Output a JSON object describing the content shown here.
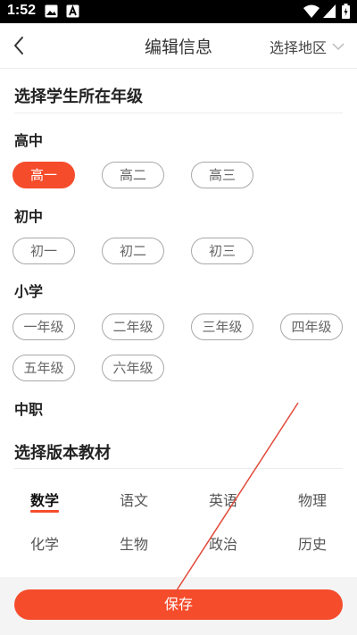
{
  "status_bar": {
    "time": "1:52",
    "icons": [
      "image-icon",
      "a-app-icon",
      "wifi-icon",
      "signal-icon",
      "battery-icon"
    ]
  },
  "nav": {
    "title": "编辑信息",
    "region_label": "选择地区",
    "back_icon": "chevron-left-icon"
  },
  "grade_section": {
    "heading": "选择学生所在年级",
    "groups": [
      {
        "label": "高中",
        "grades": [
          "高一",
          "高二",
          "高三"
        ],
        "selected": "高一"
      },
      {
        "label": "初中",
        "grades": [
          "初一",
          "初二",
          "初三"
        ]
      },
      {
        "label": "小学",
        "grades": [
          "一年级",
          "二年级",
          "三年级",
          "四年级",
          "五年级",
          "六年级"
        ]
      },
      {
        "label": "中职",
        "grades": []
      }
    ]
  },
  "textbook_section": {
    "heading": "选择版本教材",
    "subjects": [
      "数学",
      "语文",
      "英语",
      "物理",
      "化学",
      "生物",
      "政治",
      "历史"
    ],
    "selected": "数学"
  },
  "save_label": "保存",
  "colors": {
    "accent": "#f54c2c",
    "pill_border": "#a8a8a8",
    "status_bar": "#000000"
  }
}
